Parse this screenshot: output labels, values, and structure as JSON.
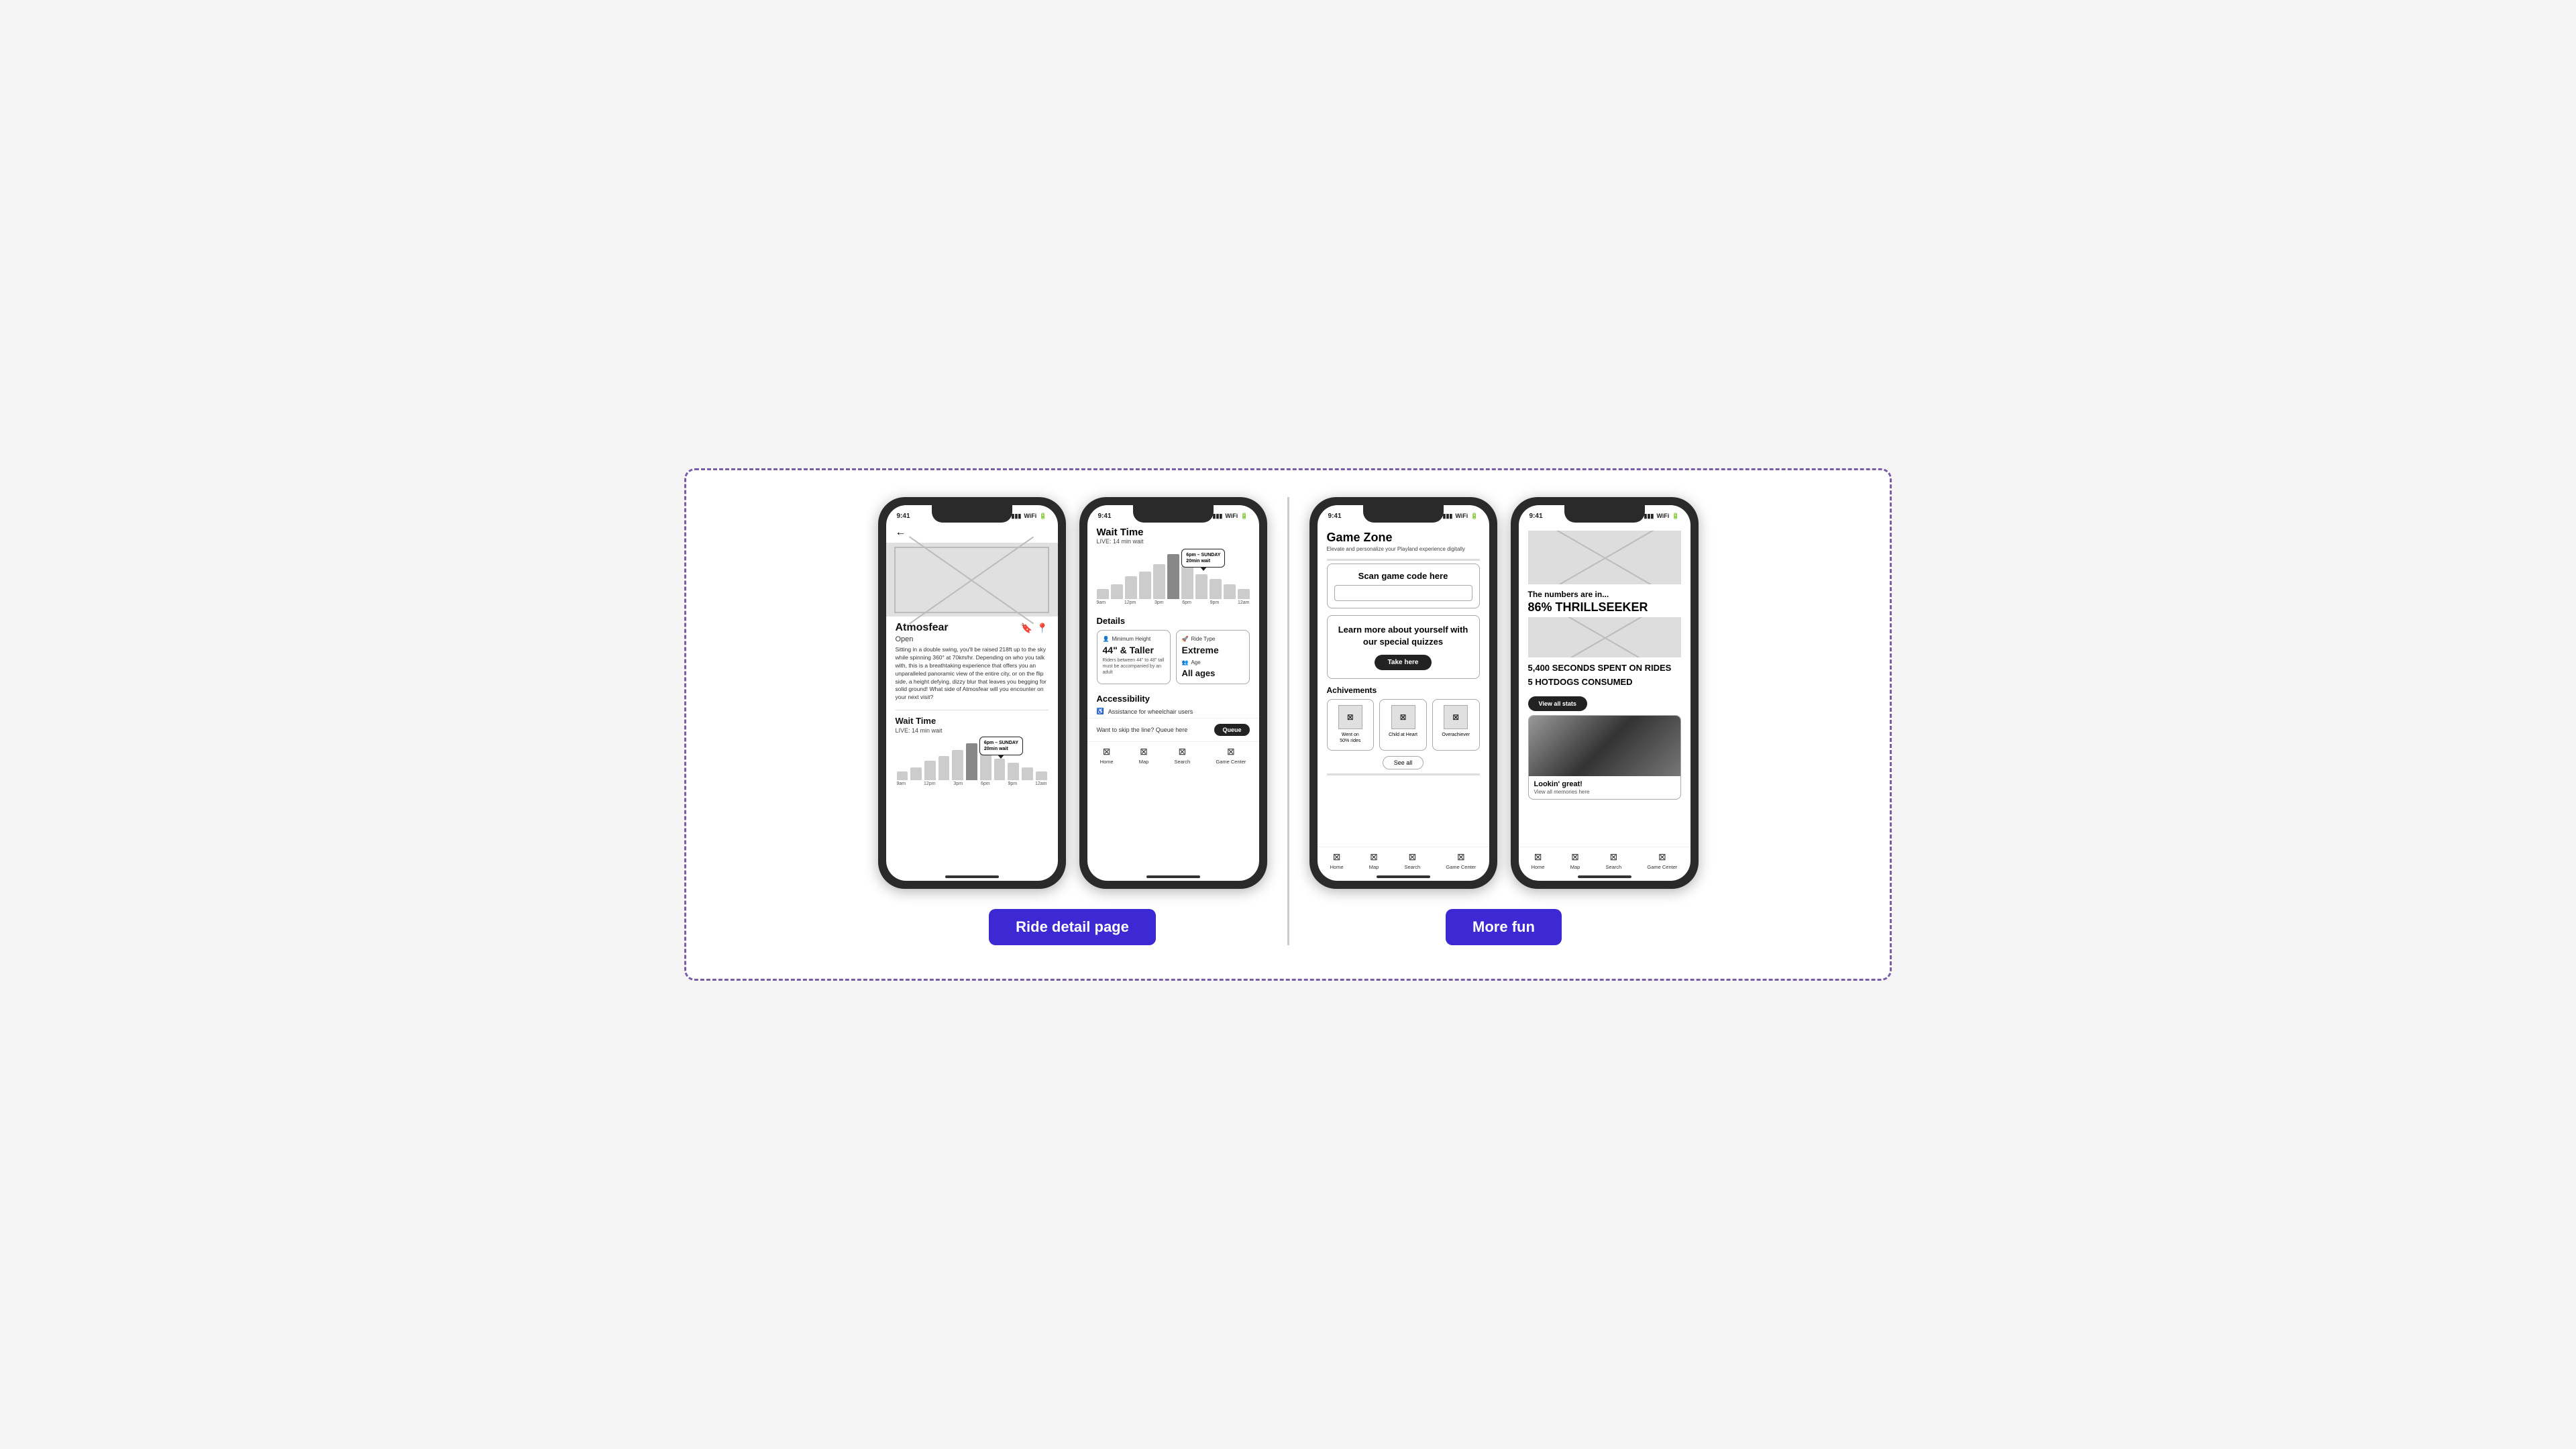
{
  "page": {
    "background_border_color": "#7b5ea7",
    "section1_label": "Ride detail page",
    "section2_label": "More fun",
    "accent_color": "#3c29d4"
  },
  "phone1": {
    "status_time": "9:41",
    "title": "Atmosfear",
    "open_status": "Open",
    "description": "Sitting in a double swing, you'll be raised 218ft up to the sky while spinning 360° at 70km/hr. Depending on who you talk with, this is a breathtaking experience that offers you an unparalleled panoramic view of the entire city, or on the flip side, a height defying, dizzy blur that leaves you begging for solid ground! What side of Atmosfear will you encounter on your next visit?",
    "wait_title": "Wait Time",
    "wait_live": "LIVE: 14 min wait",
    "tooltip": "6pm – SUNDAY\n20min wait",
    "chart_labels": [
      "9am",
      "12pm",
      "3pm",
      "6pm",
      "9pm",
      "12am"
    ],
    "chart_bars": [
      20,
      30,
      45,
      55,
      70,
      60,
      50,
      40,
      35,
      30,
      25
    ]
  },
  "phone2": {
    "status_time": "9:41",
    "title": "Wait Time",
    "live": "LIVE: 14 min wait",
    "tooltip": "6pm – SUNDAY\n20min wait",
    "chart_labels": [
      "9am",
      "12pm",
      "3pm",
      "6pm",
      "9pm",
      "12am"
    ],
    "chart_bars": [
      20,
      30,
      45,
      55,
      70,
      60,
      50,
      40,
      35,
      30,
      25
    ],
    "details_title": "Details",
    "min_height_label": "Minimum Height",
    "min_height_value": "44\" & Taller",
    "min_height_sub": "Riders between 44\" to 48\" tall must be accompanied by an adult",
    "ride_type_label": "Ride Type",
    "ride_type_value": "Extreme",
    "ride_type_icon": "🚀",
    "age_label": "Age",
    "age_value": "All ages",
    "accessibility_title": "Accessibility",
    "accessibility_item": "Assistance for wheelchair users",
    "queue_text": "Want to skip the line? Queue here",
    "queue_btn": "Queue",
    "nav_items": [
      "Home",
      "Map",
      "Search",
      "Game Center"
    ]
  },
  "phone3": {
    "status_time": "9:41",
    "title": "Game Zone",
    "subtitle": "Elevate and personalize your Playland experience digitally",
    "scan_title": "Scan game code here",
    "quiz_text": "Learn more about yourself with our special quizzes",
    "quiz_btn": "Take here",
    "achievements_title": "Achivements",
    "achievement1": "Went on\n50% rides",
    "achievement2": "Child at Heart",
    "achievement3": "Overachiever",
    "see_all_btn": "See all",
    "nav_items": [
      "Home",
      "Map",
      "Search",
      "Game Center"
    ]
  },
  "phone4": {
    "status_time": "9:41",
    "header_text": "The numbers are in...",
    "stat1_value": "86% THRILLSEEKER",
    "stat2_value": "5,400 SECONDS SPENT ON RIDES",
    "stat3_value": "5 HOTDOGS CONSUMED",
    "view_all_btn": "View all stats",
    "memory_title": "Lookin' great!",
    "memory_sub": "View all memories here",
    "nav_items": [
      "Home",
      "Map",
      "Search",
      "Game Center"
    ]
  }
}
